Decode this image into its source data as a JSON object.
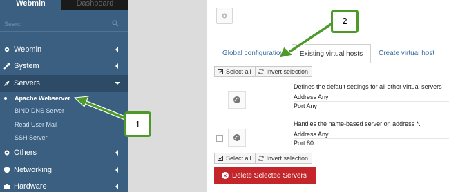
{
  "topbar": {
    "webmin_tab": "Webmin",
    "dashboard_tab": "Dashboard"
  },
  "search": {
    "placeholder": "Search"
  },
  "nav": {
    "webmin": "Webmin",
    "system": "System",
    "servers": "Servers",
    "others": "Others",
    "networking": "Networking",
    "hardware": "Hardware"
  },
  "servers_submenu": [
    "Apache Webserver",
    "BIND DNS Server",
    "Read User Mail",
    "SSH Server"
  ],
  "tabs": [
    "Global configuration",
    "Existing virtual hosts",
    "Create virtual host"
  ],
  "buttons": {
    "select_all": "Select all",
    "invert_selection": "Invert selection",
    "delete_selected": "Delete Selected Servers"
  },
  "hosts": [
    {
      "description": "Defines the default settings for all other virtual servers",
      "address_label": "Address",
      "address_value": "Any",
      "port_label": "Port",
      "port_value": "Any"
    },
    {
      "description": "Handles the name-based server  on address  *.",
      "address_label": "Address",
      "address_value": "Any",
      "port_label": "Port",
      "port_value": "80"
    }
  ],
  "callouts": {
    "one": "1",
    "two": "2"
  },
  "colors": {
    "sidebar": "#3b5f80",
    "delete": "#c4252a",
    "callout_green": "#4d9a2a"
  }
}
